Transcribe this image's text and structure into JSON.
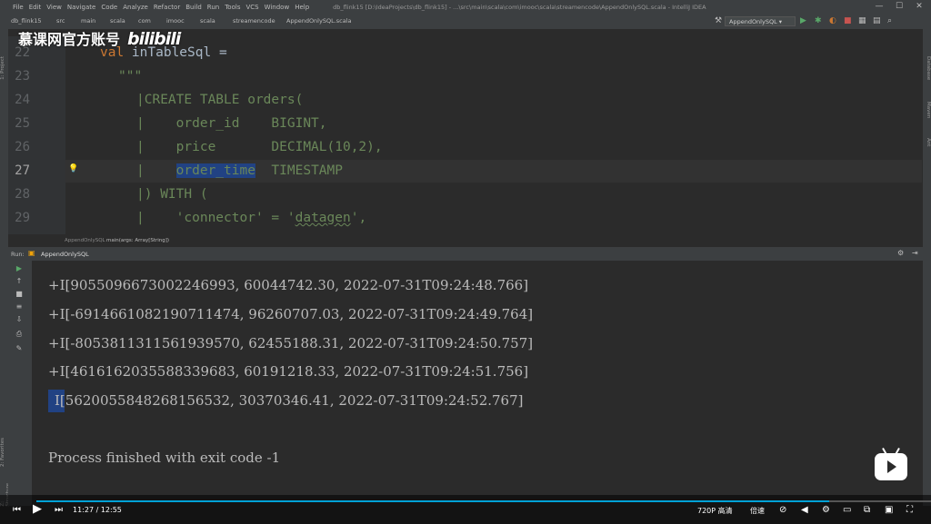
{
  "window": {
    "menu": [
      "File",
      "Edit",
      "View",
      "Navigate",
      "Code",
      "Analyze",
      "Refactor",
      "Build",
      "Run",
      "Tools",
      "VCS",
      "Window",
      "Help"
    ],
    "title": "db_flink15 [D:\\IdeaProjects\\db_flink15] - ...\\src\\main\\scala\\com\\imooc\\scala\\streamencode\\AppendOnlySQL.scala - IntelliJ IDEA"
  },
  "navbar": {
    "crumbs": [
      "db_flink15",
      "src",
      "main",
      "scala",
      "com",
      "imooc",
      "scala",
      "streamencode",
      "AppendOnlySQL.scala"
    ],
    "run_config": "AppendOnlySQL"
  },
  "editor": {
    "line_numbers": [
      "22",
      "23",
      "24",
      "25",
      "26",
      "27",
      "28",
      "29"
    ],
    "current_line": "27",
    "breadcrumb": [
      "AppendOnlySQL",
      "main(args: Array[String])"
    ]
  },
  "run": {
    "label": "Run:",
    "tab": "AppendOnlySQL",
    "output": [
      "+I[9055096673002246993, 60044742.30, 2022-07-31T09:24:48.766]",
      "+I[-6914661082190711474, 96260707.03, 2022-07-31T09:24:49.764]",
      "+I[-8053811311561939570, 62455188.31, 2022-07-31T09:24:50.757]",
      "+I[4616162035588339683, 60191218.33, 2022-07-31T09:24:51.756]",
      "I[5620055848268156532, 30370346.41, 2022-07-31T09:24:52.767]"
    ],
    "finished": "Process finished with exit code -1"
  },
  "watermark": {
    "text": "慕课网官方账号",
    "logo": "bilibili"
  },
  "player": {
    "time": "11:27 / 12:55",
    "quality": "720P 高清",
    "speed": "倍速",
    "progress": 0.886
  },
  "stripes": {
    "left": [
      "1: Project",
      "2: Favorites",
      "Z: Structure"
    ],
    "right": [
      "Database",
      "Maven",
      "Ant"
    ]
  },
  "colors": {
    "keyword": "#cc7832",
    "string": "#6a8759",
    "selection": "#214283",
    "bilibili_blue": "#00a1d6"
  }
}
